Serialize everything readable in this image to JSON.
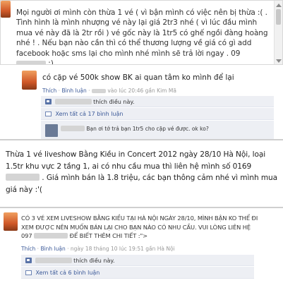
{
  "post1": {
    "text": "Mọi người ơi mình còn thừa 1 vé ( vì bận mình có việc nên bị thừa :( . Tình hình là mình nhượng vé này lại giá 2tr3 nhé ( vì lúc đầu mình mua vé này đã là 2tr rồi ) vé gốc này là 1tr5 có ghế ngồi đàng hoàng nhé ! . Nếu bạn nào cần thì có thể thương lượng về giá có gì add facebook hoặc sms lại cho mình nhé mình sẽ trả lời ngay . 09",
    "phone_tail": ":)"
  },
  "post2": {
    "text": "có cặp vé 500k show BK ai quan tâm ko mình để lại",
    "meta": {
      "like": "Thích",
      "comment": "Bình luận",
      "time": "vào lúc 20:46 gần Kim Mã"
    },
    "like_text": "thích điều này.",
    "view_comments": "Xem tất cả 17 bình luận",
    "comment_text": "Bạn ơi tớ trả bạn 1tr5 cho cặp vé được. ok ko?",
    "comment_time": "27 giây trước · Thích"
  },
  "post3": {
    "text_a": "Thừa 1 vé liveshow Bằng Kiều in Concert 2012 ngày 28/10 Hà Nội, loại 1.5tr khu vực 2 tầng 1, ai có nhu cầu mua thì liên hệ mình số 0169",
    "text_b": ". Giá mình bán là 1.8 triệu, các bạn thông cảm nhé vì mình mua giá này :'("
  },
  "post4": {
    "text_a": "CÓ 3 VÉ XEM LIVESHOW BẰNG KIỀU TẠI HÀ NỘI NGÀY 28/10, MÌNH BẬN KO THỂ ĐI XEM ĐƯỢC NÊN MUỐN BÁN LẠI CHO BẠN NÀO CÓ NHU CẦU. VUI LÒNG LIÊN HỆ 097",
    "text_b": "ĐỂ BIẾT THÊM CHI TIẾT :\">",
    "meta": {
      "like": "Thích",
      "comment": "Bình luận",
      "time": "ngày 18 tháng 10 lúc 19:51 gần Hà Nội"
    },
    "like_text": "thích điều này.",
    "view_comments": "Xem tất cả 6 bình luận"
  }
}
